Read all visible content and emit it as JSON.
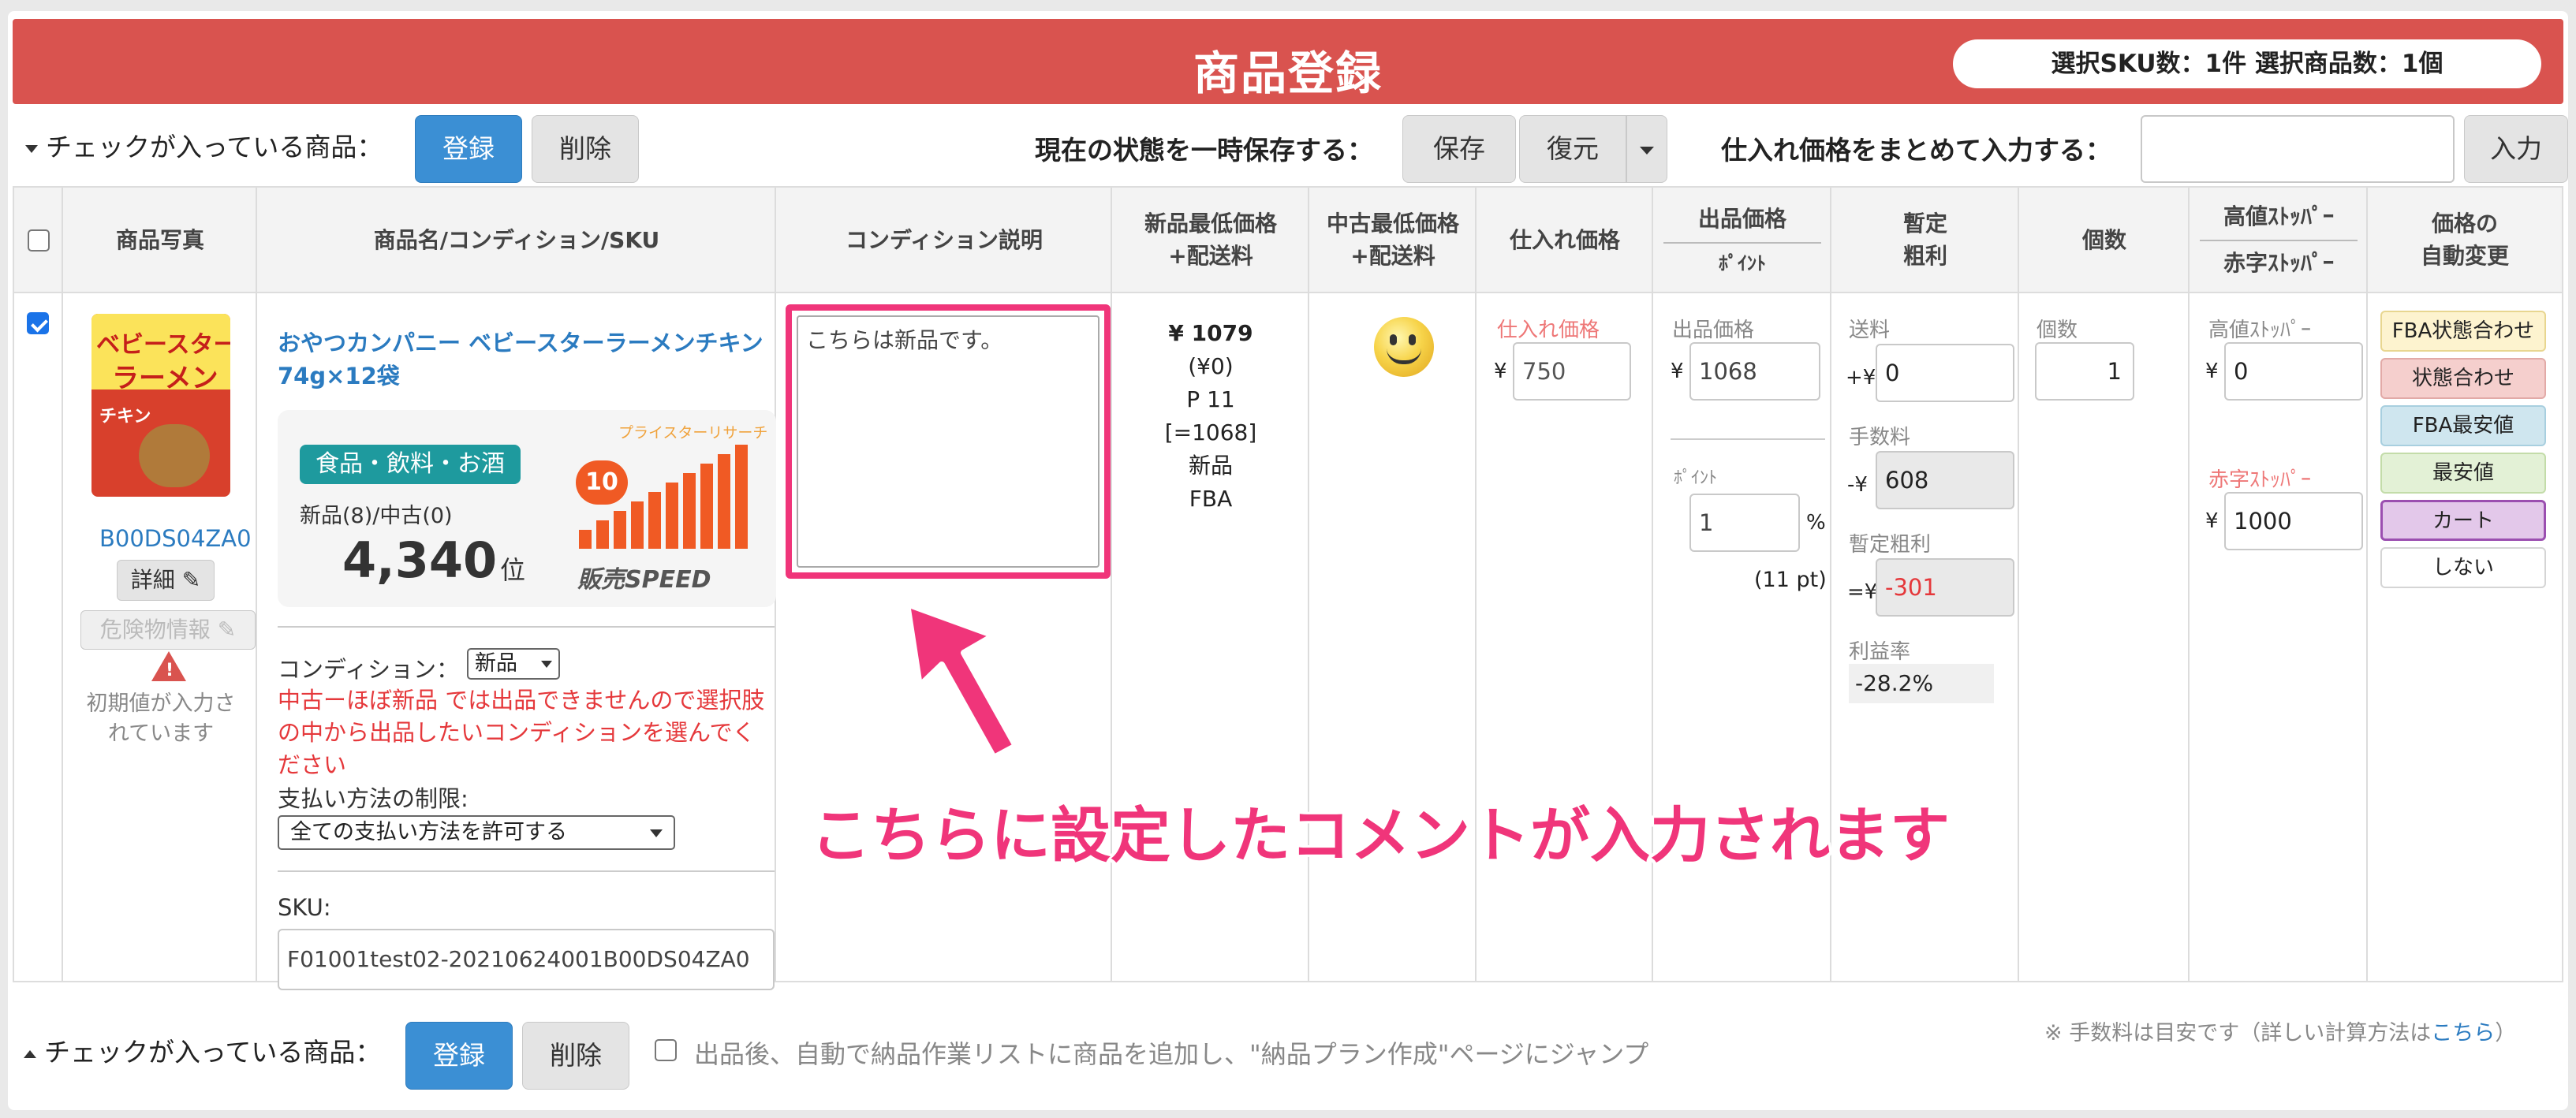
{
  "header": {
    "title": "商品登録",
    "summary": "選択SKU数：1件 選択商品数：1個"
  },
  "toolbar": {
    "checked_label": "チェックが入っている商品：",
    "register": "登録",
    "delete": "削除",
    "save_state_label": "現在の状態を一時保存する：",
    "save": "保存",
    "restore": "復元",
    "bulk_price_label": "仕入れ価格をまとめて入力する：",
    "bulk_price_value": "",
    "enter": "入力"
  },
  "columns": {
    "photo": "商品写真",
    "name": "商品名/コンディション/SKU",
    "condition_desc": "コンディション説明",
    "new_min_1": "新品最低価格",
    "new_min_2": "+配送料",
    "used_min_1": "中古最低価格",
    "used_min_2": "+配送料",
    "purchase": "仕入れ価格",
    "list_price": "出品価格",
    "point": "ﾎﾟｲﾝﾄ",
    "profit_1": "暫定",
    "profit_2": "粗利",
    "qty": "個数",
    "high_stopper": "高値ｽﾄｯﾊﾟｰ",
    "low_stopper": "赤字ｽﾄｯﾊﾟｰ",
    "auto_1": "価格の",
    "auto_2": "自動変更"
  },
  "product": {
    "package_text_1": "ベビースター",
    "package_text_2": "ラーメン",
    "package_text_3": "チキン",
    "asin": "B00DS04ZA0",
    "detail": "詳細",
    "hazmat": "危険物情報",
    "default_note": "初期値が入力されています",
    "title": "おやつカンパニー ベビースターラーメンチキン74g×12袋",
    "category": "食品・飲料・お酒",
    "offers": "新品(8)/中古(0)",
    "rank": "4,340",
    "rank_unit": "位",
    "speed_label": "プライスターリサーチ",
    "speed_value": "10",
    "speed_brand": "販売SPEED",
    "condition_label": "コンディション：",
    "condition_value": "新品",
    "condition_warning": "中古ーほぼ新品 では出品できませんので選択肢の中から出品したいコンディションを選んでください",
    "payment_label": "支払い方法の制限:",
    "payment_value": "全ての支払い方法を許可する",
    "sku_label": "SKU:",
    "sku_value": "F01001test02-20210624001B00DS04ZA0",
    "condition_note": "こちらは新品です。",
    "new_min_price": "¥ 1079",
    "new_min_ship": "(¥0)",
    "new_min_points": "P 11",
    "new_min_eq": "[=1068]",
    "new_min_cond": "新品",
    "new_min_channel": "FBA",
    "purchase_label": "仕入れ価格",
    "purchase_value": "750",
    "list_label": "出品価格",
    "list_value": "1068",
    "point_label": "ﾎﾟｲﾝﾄ",
    "point_value": "1",
    "point_pct": "%",
    "point_pt": "(11 pt)",
    "shipping_label": "送料",
    "shipping_prefix": "+¥",
    "shipping_value": "0",
    "fee_label": "手数料",
    "fee_prefix": "-¥",
    "fee_value": "608",
    "profit_label": "暫定粗利",
    "profit_prefix": "=¥",
    "profit_value": "-301",
    "margin_label": "利益率",
    "margin_value": "-28.2%",
    "qty_label": "個数",
    "qty_value": "1",
    "high_label": "高値ｽﾄｯﾊﾟｰ",
    "high_value": "0",
    "low_label": "赤字ｽﾄｯﾊﾟｰ",
    "low_value": "1000",
    "yen": "¥"
  },
  "auto_options": [
    {
      "label": "FBA状態合わせ",
      "bg": "#fdf3cf",
      "border": "#e8d690"
    },
    {
      "label": "状態合わせ",
      "bg": "#f5cfcd",
      "border": "#e2aaa7"
    },
    {
      "label": "FBA最安値",
      "bg": "#cfe6ef",
      "border": "#a8cfdf"
    },
    {
      "label": "最安値",
      "bg": "#e3f1d6",
      "border": "#c3dca9"
    },
    {
      "label": "カート",
      "bg": "#e3c8ea",
      "border": "#9b4fb0"
    },
    {
      "label": "しない",
      "bg": "#ffffff",
      "border": "#d5d5d5"
    }
  ],
  "annotation": "こちらに設定したコメントが入力されます",
  "footer": {
    "checked_label": "チェックが入っている商品：",
    "register": "登録",
    "delete": "削除",
    "auto_shipment": "出品後、自動で納品作業リストに商品を追加し、\"納品プラン作成\"ページにジャンプ",
    "fee_note": "※ 手数料は目安です（詳しい計算方法は",
    "fee_link": "こちら",
    "fee_note_end": "）"
  },
  "colors": {
    "header": "#d9534f",
    "primary_button": "#3b8fd4",
    "highlight": "#f0357a",
    "warning": "#e5383b"
  }
}
